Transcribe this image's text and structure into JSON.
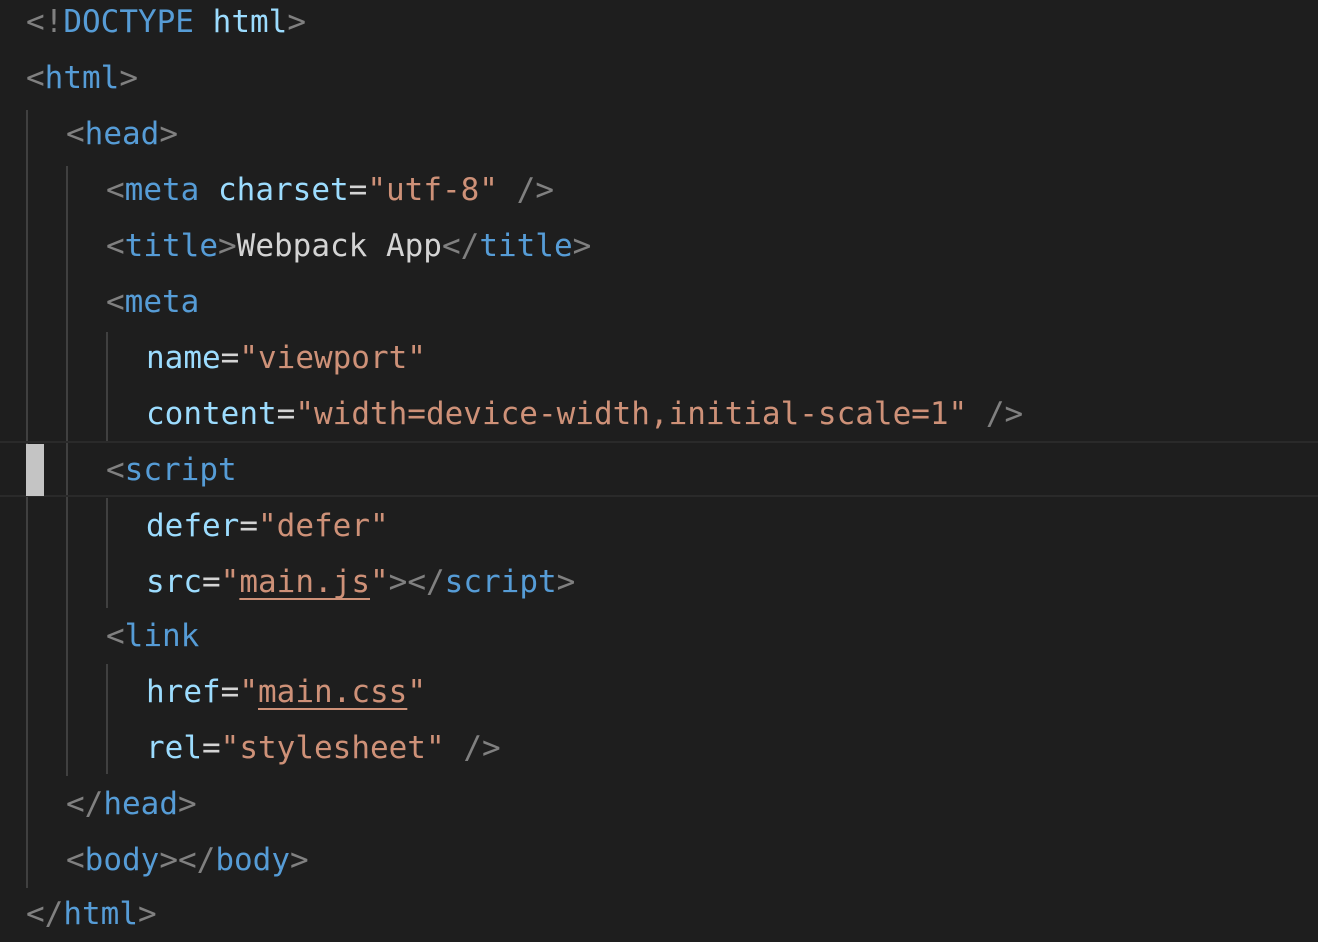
{
  "editor": {
    "language": "html",
    "current_line": 9,
    "lines": [
      {
        "doctype_open": "<!",
        "doctype_kw": "DOCTYPE",
        "doctype_space": " ",
        "doctype_html": "html",
        "doctype_close": ">"
      },
      {
        "open": "<",
        "tag": "html",
        "close": ">"
      },
      {
        "open": "<",
        "tag": "head",
        "close": ">"
      },
      {
        "open": "<",
        "tag": "meta",
        "space": " ",
        "attr": "charset",
        "eq": "=",
        "val": "\"utf-8\"",
        "sp2": " ",
        "close": "/>"
      },
      {
        "open": "<",
        "tag": "title",
        "close": ">",
        "text": "Webpack App",
        "open2": "</",
        "tag2": "title",
        "close2": ">"
      },
      {
        "open": "<",
        "tag": "meta"
      },
      {
        "attr": "name",
        "eq": "=",
        "val": "\"viewport\""
      },
      {
        "attr": "content",
        "eq": "=",
        "val": "\"width=device-width,initial-scale=1\"",
        "sp2": " ",
        "close": "/>"
      },
      {
        "open": "<",
        "tag": "script"
      },
      {
        "attr": "defer",
        "eq": "=",
        "val": "\"defer\""
      },
      {
        "attr": "src",
        "eq": "=",
        "q1": "\"",
        "link": "main.js",
        "q2": "\"",
        "close": ">",
        "open2": "</",
        "tag2": "script",
        "close2": ">"
      },
      {
        "open": "<",
        "tag": "link"
      },
      {
        "attr": "href",
        "eq": "=",
        "q1": "\"",
        "link": "main.css",
        "q2": "\""
      },
      {
        "attr": "rel",
        "eq": "=",
        "val": "\"stylesheet\"",
        "sp2": " ",
        "close": "/>"
      },
      {
        "open": "</",
        "tag": "head",
        "close": ">"
      },
      {
        "open": "<",
        "tag": "body",
        "close": ">",
        "open2": "</",
        "tag2": "body",
        "close2": ">"
      },
      {
        "open": "</",
        "tag": "html",
        "close": ">"
      }
    ]
  },
  "colors": {
    "background": "#1e1e1e",
    "punctuation": "#808080",
    "tag": "#569cd6",
    "attribute": "#9cdcfe",
    "string": "#ce9178",
    "text": "#d4d4d4",
    "cursor": "#c4c4c4"
  }
}
